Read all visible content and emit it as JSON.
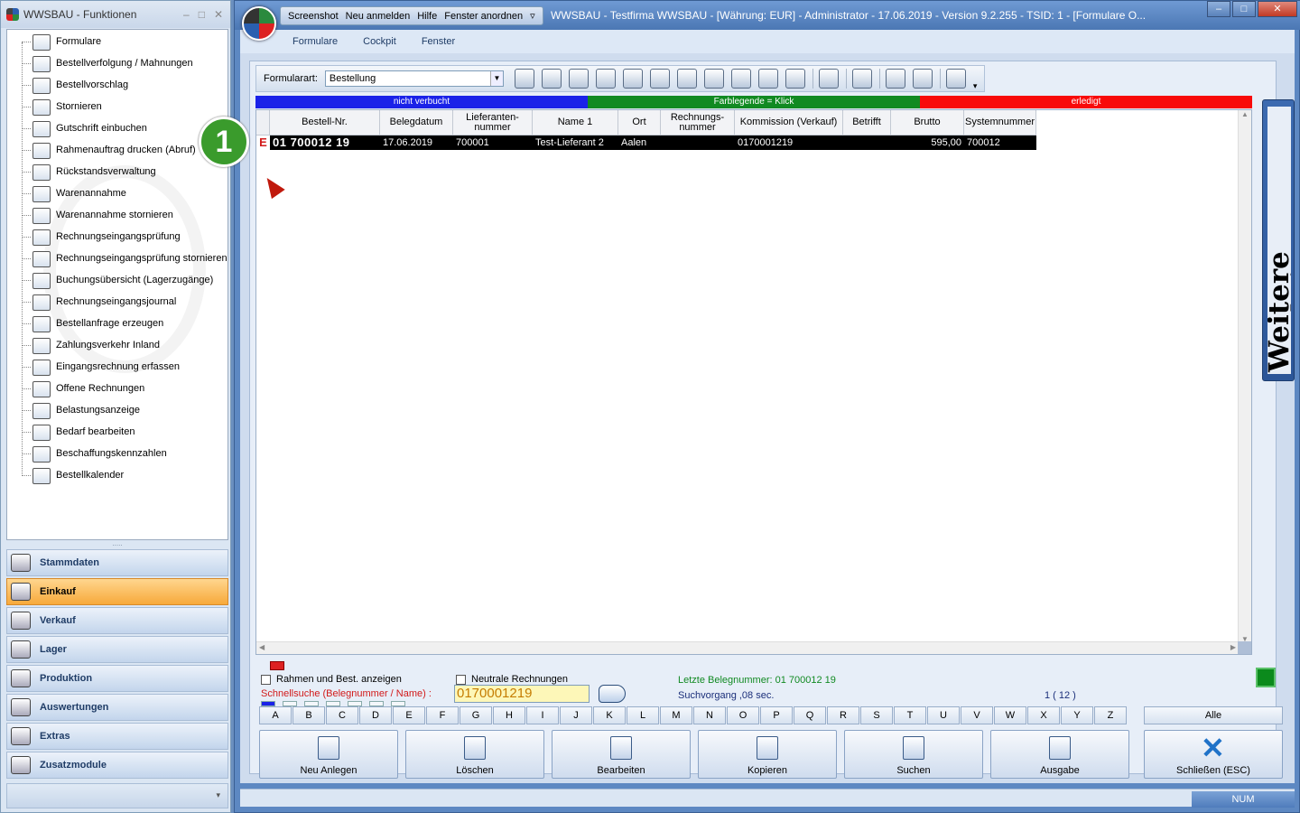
{
  "left_window": {
    "title": "WWSBAU - Funktionen",
    "min": "–",
    "max": "□",
    "close": "✕",
    "tree_items": [
      {
        "label": "Formulare",
        "icon": "document-icon"
      },
      {
        "label": "Bestellverfolgung / Mahnungen",
        "icon": "map-icon"
      },
      {
        "label": "Bestellvorschlag",
        "icon": "cart-icon"
      },
      {
        "label": "Stornieren",
        "icon": "cart-cancel-icon"
      },
      {
        "label": "Gutschrift einbuchen",
        "icon": "credit-note-icon"
      },
      {
        "label": "Rahmenauftrag drucken (Abruf)",
        "icon": "print-document-icon"
      },
      {
        "label": "Rückstandsverwaltung",
        "icon": "clock-back-icon"
      },
      {
        "label": "Warenannahme",
        "icon": "goods-receipt-icon"
      },
      {
        "label": "Warenannahme stornieren",
        "icon": "goods-receipt-cancel-icon"
      },
      {
        "label": "Rechnungseingangsprüfung",
        "icon": "euro-invoice-icon"
      },
      {
        "label": "Rechnungseingangsprüfung stornieren",
        "icon": "euro-invoice-cancel-icon"
      },
      {
        "label": "Buchungsübersicht (Lagerzugänge)",
        "icon": "ledger-icon"
      },
      {
        "label": "Rechnungseingangsjournal",
        "icon": "journal-icon"
      },
      {
        "label": "Bestellanfrage erzeugen",
        "icon": "request-icon"
      },
      {
        "label": "Zahlungsverkehr Inland",
        "icon": "payment-icon"
      },
      {
        "label": "Eingangsrechnung erfassen",
        "icon": "euro-capture-icon"
      },
      {
        "label": "Offene Rechnungen",
        "icon": "open-invoice-icon"
      },
      {
        "label": "Belastungsanzeige",
        "icon": "weight-icon"
      },
      {
        "label": "Bedarf bearbeiten",
        "icon": "basket-icon"
      },
      {
        "label": "Beschaffungskennzahlen",
        "icon": "metrics-calendar-icon"
      },
      {
        "label": "Bestellkalender",
        "icon": "calendar-icon"
      }
    ],
    "splitter": ".....",
    "nav": [
      {
        "label": "Stammdaten",
        "active": false
      },
      {
        "label": "Einkauf",
        "active": true
      },
      {
        "label": "Verkauf",
        "active": false
      },
      {
        "label": "Lager",
        "active": false
      },
      {
        "label": "Produktion",
        "active": false
      },
      {
        "label": "Auswertungen",
        "active": false
      },
      {
        "label": "Extras",
        "active": false
      },
      {
        "label": "Zusatzmodule",
        "active": false
      }
    ],
    "footer_arrow": "▾"
  },
  "main_window": {
    "quick_access": [
      "Screenshot",
      "Neu anmelden",
      "Hilfe",
      "Fenster anordnen"
    ],
    "title": "WWSBAU - Testfirma WWSBAU - [Währung: EUR] - Administrator - 17.06.2019 - Version 9.2.255 - TSID: 1 - [Formulare O...",
    "win_min": "–",
    "win_max": "□",
    "win_close": "✕",
    "menu": [
      "Formulare",
      "Cockpit",
      "Fenster"
    ]
  },
  "toolbar": {
    "formularart_label": "Formularart:",
    "formularart_value": "Bestellung",
    "dropdown_arrow": "▼",
    "icons": [
      "clipboard-icon",
      "pen-edit-icon",
      "delete-icon",
      "euro-check-icon",
      "euro-cancel-icon",
      "cart-lock-icon",
      "cart-lock2-icon",
      "book-cancel-icon",
      "cart-transfer-icon",
      "info-doc-icon",
      "tree-add-icon",
      "monitor-icon",
      "sort-down-icon",
      "page-icon",
      "window-icon",
      "basket-icon"
    ],
    "overflow": "▾"
  },
  "legend": {
    "blue": "nicht verbucht",
    "green": "Farblegende = Klick",
    "red": "erledigt",
    "colors": {
      "blue": "#1a22e8",
      "green": "#118a22",
      "red": "#f80a0a"
    }
  },
  "grid": {
    "columns": [
      {
        "label": "Bestell-Nr."
      },
      {
        "label": "Belegdatum"
      },
      {
        "label": "Lieferanten-\nnummer"
      },
      {
        "label": "Name 1"
      },
      {
        "label": "Ort"
      },
      {
        "label": "Rechnungs-\nnummer"
      },
      {
        "label": "Kommission (Verkauf)"
      },
      {
        "label": "Betrifft"
      },
      {
        "label": "Brutto"
      },
      {
        "label": "Systemnummer"
      }
    ],
    "rows": [
      {
        "marker": "E",
        "bestell_nr": "01 700012 19",
        "belegdatum": "17.06.2019",
        "lieferantennummer": "700001",
        "name1": "Test-Lieferant 2",
        "ort": "Aalen",
        "rechnungsnummer": "",
        "kommission": "0170001219",
        "betrifft": "",
        "brutto": "595,00",
        "systemnummer": "700012"
      }
    ],
    "scroll_up": "▲",
    "scroll_down": "▼",
    "scroll_left": "◀",
    "scroll_right": "▶"
  },
  "step_badge": "1",
  "side_tab": "Weitere Funktionen",
  "bottom": {
    "rahmen_label": "Rahmen und Best. anzeigen",
    "neutrale_label": "Neutrale Rechnungen",
    "schnellsuche_label": "Schnellsuche (Belegnummer / Name) :",
    "schnellsuche_value": "0170001219",
    "letzte_belegnummer": "Letzte Belegnummer: 01 700012 19",
    "suchvorgang": "Suchvorgang ,08 sec.",
    "page_count": "1  ( 12 )",
    "alphabet": [
      "A",
      "B",
      "C",
      "D",
      "E",
      "F",
      "G",
      "H",
      "I",
      "J",
      "K",
      "L",
      "M",
      "N",
      "O",
      "P",
      "Q",
      "R",
      "S",
      "T",
      "U",
      "V",
      "W",
      "X",
      "Y",
      "Z"
    ],
    "alle": "Alle",
    "actions": [
      {
        "label": "Neu Anlegen",
        "icon": "new-document-icon"
      },
      {
        "label": "Löschen",
        "icon": "recycle-bin-icon"
      },
      {
        "label": "Bearbeiten",
        "icon": "edit-document-icon"
      },
      {
        "label": "Kopieren",
        "icon": "copy-icon"
      },
      {
        "label": "Suchen",
        "icon": "binoculars-icon"
      },
      {
        "label": "Ausgabe",
        "icon": "printer-icon"
      },
      {
        "label": "Schließen (ESC)",
        "icon": "close-x-icon"
      }
    ]
  },
  "status": {
    "num": "NUM"
  }
}
